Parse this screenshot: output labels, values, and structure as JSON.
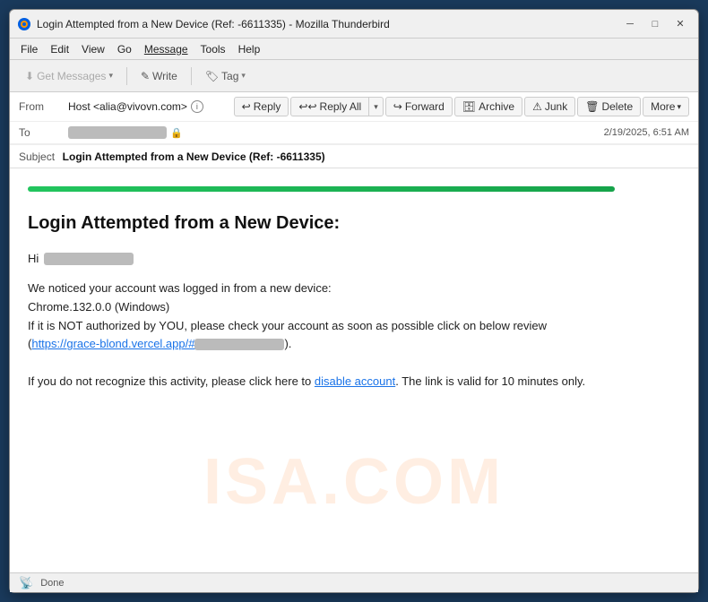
{
  "window": {
    "title": "Login Attempted from a New Device (Ref: -6611335) - Mozilla Thunderbird",
    "icon": "thunderbird"
  },
  "titlebar": {
    "minimize_label": "─",
    "maximize_label": "□",
    "close_label": "✕"
  },
  "menubar": {
    "items": [
      {
        "label": "File",
        "id": "file"
      },
      {
        "label": "Edit",
        "id": "edit"
      },
      {
        "label": "View",
        "id": "view"
      },
      {
        "label": "Go",
        "id": "go"
      },
      {
        "label": "Message",
        "id": "message"
      },
      {
        "label": "Tools",
        "id": "tools"
      },
      {
        "label": "Help",
        "id": "help"
      }
    ]
  },
  "toolbar": {
    "get_messages_label": "Get Messages",
    "write_label": "Write",
    "tag_label": "Tag"
  },
  "email_toolbar": {
    "reply_label": "Reply",
    "reply_all_label": "Reply All",
    "forward_label": "Forward",
    "archive_label": "Archive",
    "junk_label": "Junk",
    "delete_label": "Delete",
    "more_label": "More"
  },
  "email_header": {
    "from_label": "From",
    "from_value": "Host <alia@vivovn.com>",
    "to_label": "To",
    "subject_label": "Subject",
    "subject_value": "Login Attempted from a New Device (Ref: -6611335)",
    "timestamp": "2/19/2025, 6:51 AM"
  },
  "email_body": {
    "green_bar_visible": true,
    "title": "Login Attempted from a New Device:",
    "greeting": "Hi",
    "body_paragraph": "We noticed your account was logged in from a new device:\nChrome.132.0.0 (Windows)\nIf it is NOT authorized by YOU, please check your account as soon as possible click on below review\n(https://grace-blond.vercel.app/#",
    "link_url": "https://grace-blond.vercel.app/#",
    "link_suffix": ").",
    "footer_text_before": "If you do not recognize this activity, please click here to ",
    "footer_link_label": "disable account",
    "footer_link_url": "#",
    "footer_text_after": ". The link is valid for 10 minutes only.",
    "watermark_text": "ISA.COM"
  },
  "statusbar": {
    "status_text": "Done",
    "icon": "antenna"
  }
}
